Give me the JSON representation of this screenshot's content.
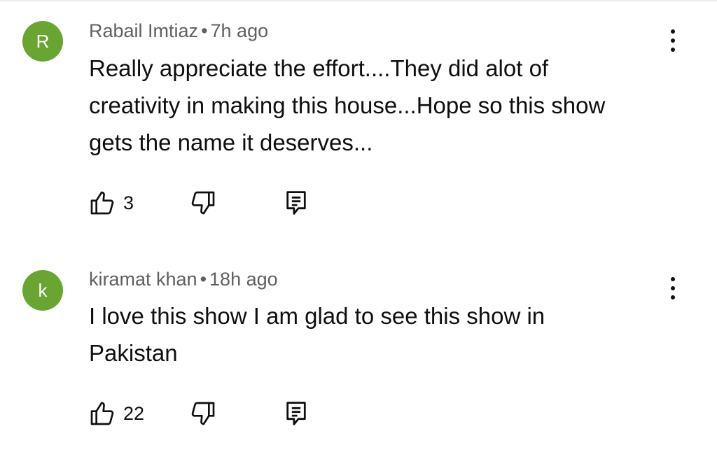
{
  "comments": [
    {
      "avatar_letter": "R",
      "author": "Rabail Imtiaz",
      "separator": "•",
      "time": "7h ago",
      "text": "Really appreciate the effort....They did alot of creativity in making this house...Hope so this show gets the name it deserves...",
      "likes": "3"
    },
    {
      "avatar_letter": "k",
      "author": "kiramat khan",
      "separator": "•",
      "time": "18h ago",
      "text": "I love this show I am glad to see this show in Pakistan",
      "likes": "22"
    }
  ],
  "colors": {
    "avatar": "#69a531",
    "meta_text": "#606060",
    "body_text": "#0f0f0f",
    "icon": "#0f0f0f"
  },
  "icons": {
    "like": "thumbs-up-icon",
    "dislike": "thumbs-down-icon",
    "reply": "reply-comment-icon",
    "more": "more-vertical-icon"
  }
}
